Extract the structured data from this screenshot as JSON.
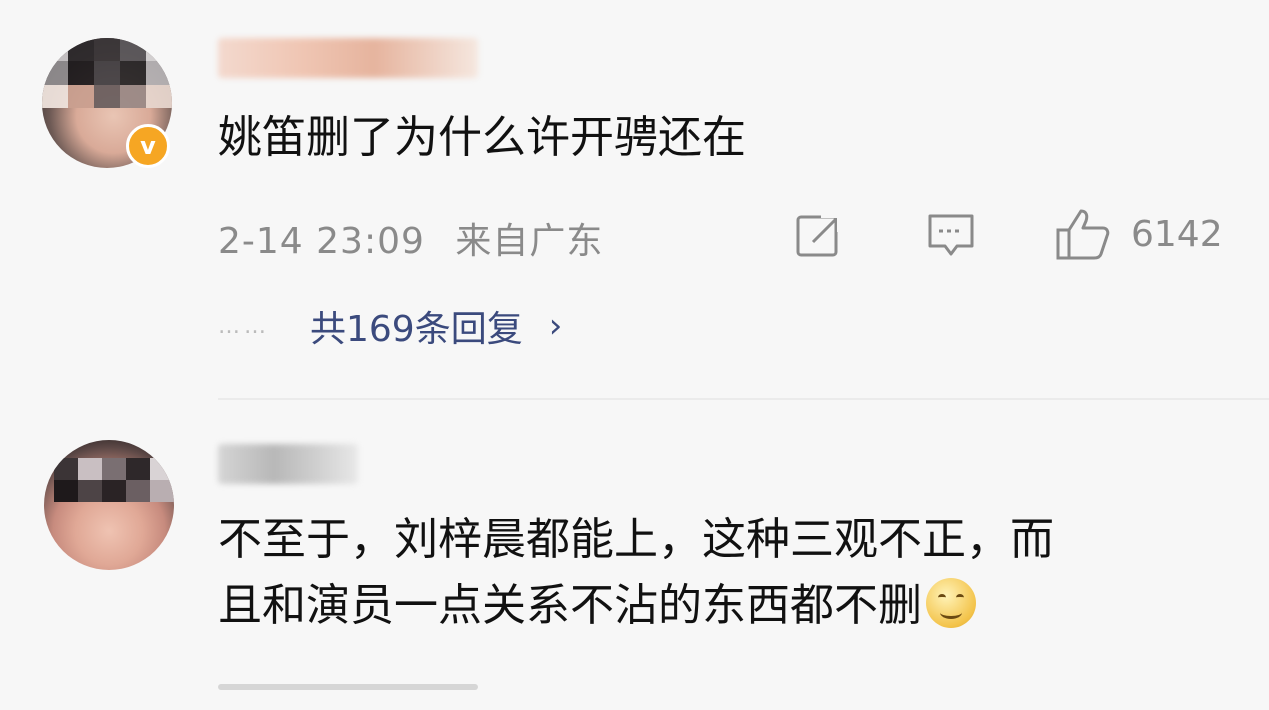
{
  "comments": [
    {
      "text": "姚笛删了为什么许开骋还在",
      "time": "2-14 23:09",
      "location": "来自广东",
      "likes": "6142",
      "replies_label": "共169条回复",
      "replies_dots": "……",
      "icons": [
        "share-icon",
        "comment-icon",
        "like-icon",
        "verified-badge-icon"
      ],
      "badge_color": "#f6a623"
    },
    {
      "text_line1": "不至于，刘梓晨都能上，这种三观不正，而",
      "text_line2": "且和演员一点关系不沾的东西都不删"
    }
  ]
}
